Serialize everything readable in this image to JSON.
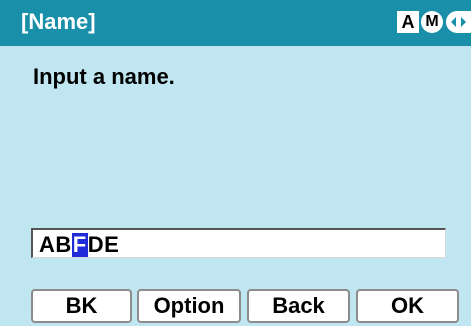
{
  "header": {
    "title": "[Name]",
    "indicator_a": "A",
    "indicator_m": "M",
    "nav_icon": "left-right-arrows-icon"
  },
  "prompt": "Input a name.",
  "input": {
    "before_cursor": "AB",
    "cursor_char": "F",
    "after_cursor": "DE"
  },
  "softkeys": {
    "bk": "BK",
    "option": "Option",
    "back": "Back",
    "ok": "OK"
  },
  "colors": {
    "header_bg": "#1a8fa9",
    "screen_bg": "#bfe6f1",
    "cursor_bg": "#1f2bd8"
  }
}
